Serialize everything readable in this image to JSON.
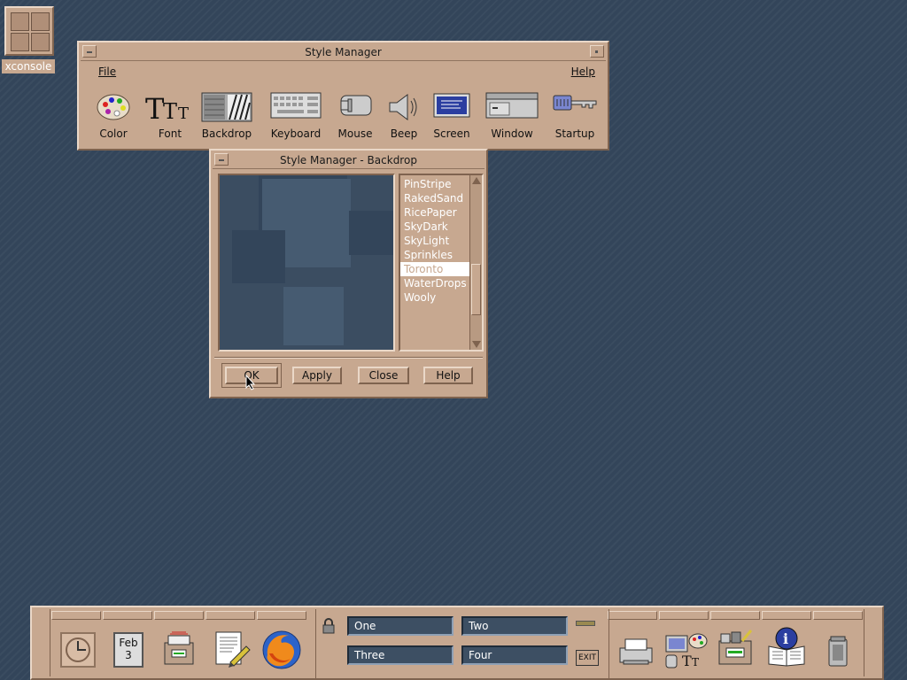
{
  "desktop_icon": {
    "label": "xconsole"
  },
  "style_manager": {
    "title": "Style Manager",
    "menu": {
      "file": "File",
      "help": "Help"
    },
    "tools": [
      {
        "label": "Color",
        "icon": "palette-icon"
      },
      {
        "label": "Font",
        "icon": "font-icon"
      },
      {
        "label": "Backdrop",
        "icon": "backdrop-icon"
      },
      {
        "label": "Keyboard",
        "icon": "keyboard-icon"
      },
      {
        "label": "Mouse",
        "icon": "mouse-icon"
      },
      {
        "label": "Beep",
        "icon": "speaker-icon"
      },
      {
        "label": "Screen",
        "icon": "monitor-icon"
      },
      {
        "label": "Window",
        "icon": "window-icon"
      },
      {
        "label": "Startup",
        "icon": "key-icon"
      }
    ]
  },
  "backdrop_dialog": {
    "title": "Style Manager - Backdrop",
    "backdrops": [
      "PinStripe",
      "RakedSand",
      "RicePaper",
      "SkyDark",
      "SkyLight",
      "Sprinkles",
      "Toronto",
      "WaterDrops",
      "Wooly"
    ],
    "selected": "Toronto",
    "buttons": {
      "ok": "OK",
      "apply": "Apply",
      "close": "Close",
      "help": "Help"
    }
  },
  "panel": {
    "calendar": {
      "month": "Feb",
      "day": "3"
    },
    "workspaces": [
      "One",
      "Two",
      "Three",
      "Four"
    ],
    "exit_label": "EXIT"
  },
  "colors": {
    "chrome": "#c7a890",
    "desktop": "#3b4d61",
    "workspace_button": "#3d4f63"
  }
}
